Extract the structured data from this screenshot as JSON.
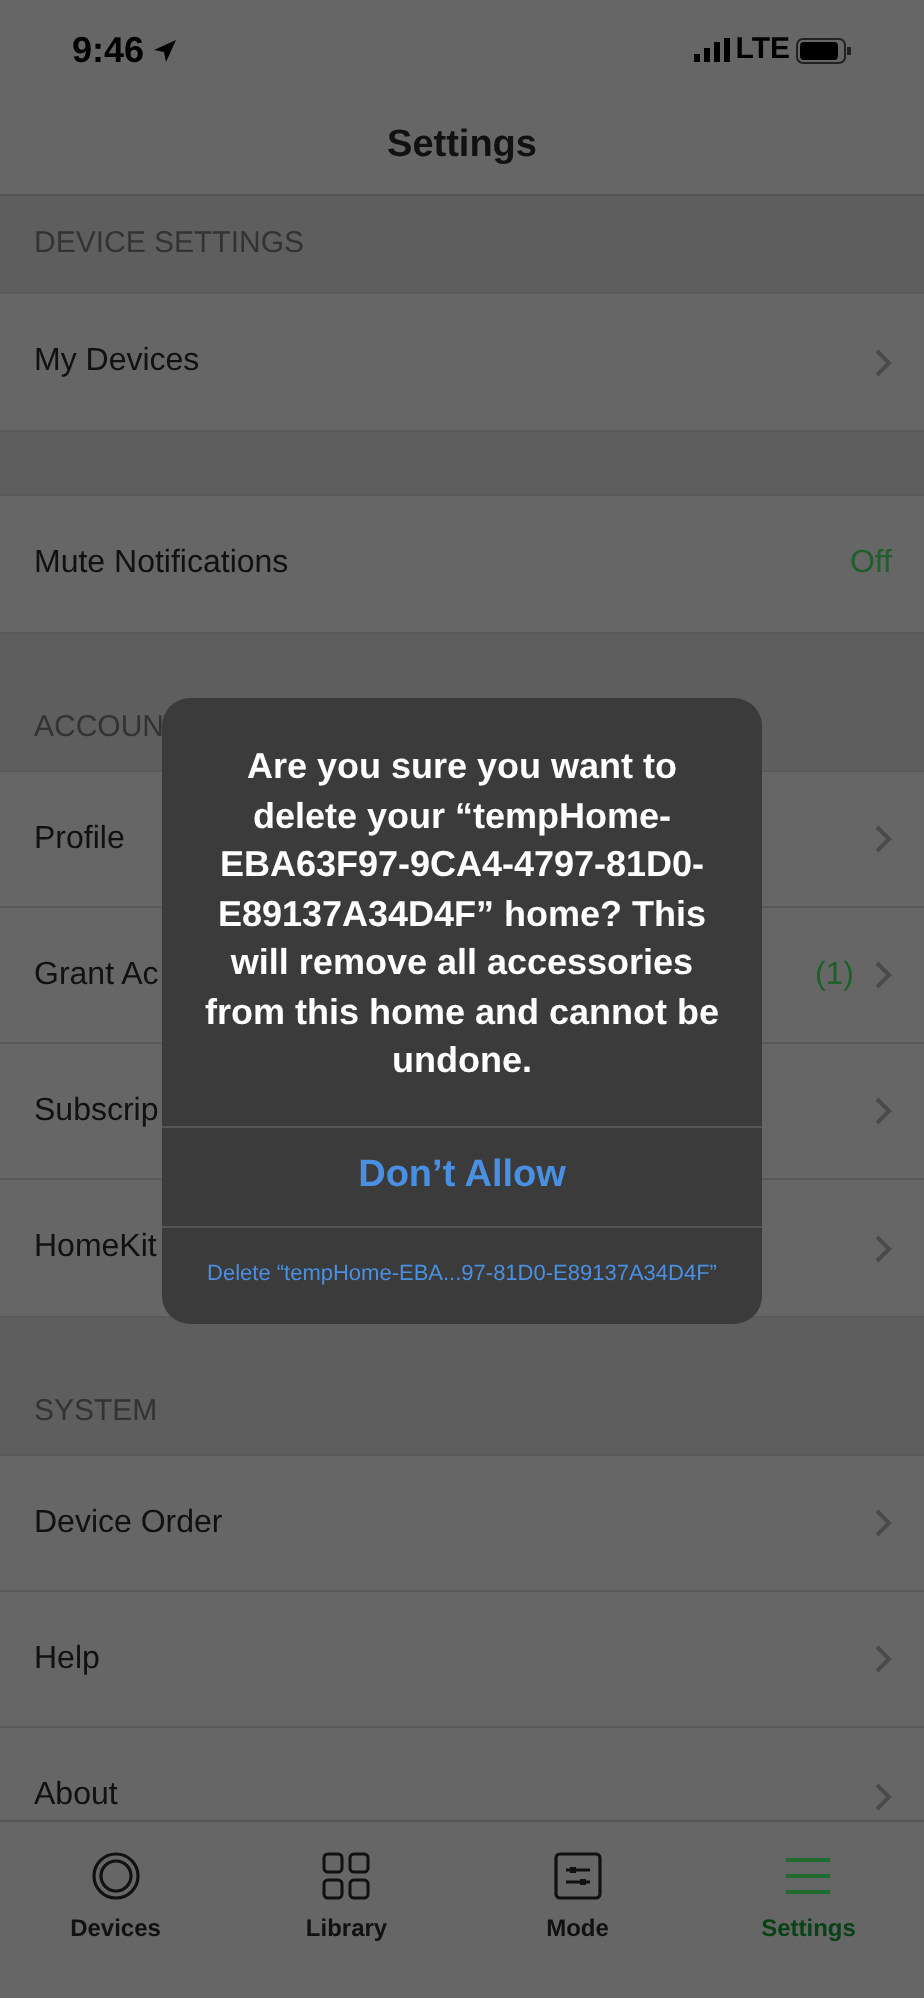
{
  "status_bar": {
    "time": "9:46",
    "network": "LTE"
  },
  "nav": {
    "title": "Settings"
  },
  "sections": [
    {
      "header": "DEVICE SETTINGS",
      "rows": [
        {
          "label": "My Devices",
          "chevron": true
        }
      ]
    },
    {
      "rows": [
        {
          "label": "Mute Notifications",
          "value": "Off",
          "chevron": false
        }
      ]
    },
    {
      "header": "ACCOUN",
      "rows": [
        {
          "label": "Profile",
          "chevron": true
        },
        {
          "label": "Grant Ac",
          "value": "(1)",
          "chevron": true
        },
        {
          "label": "Subscrip",
          "chevron": true
        },
        {
          "label": "HomeKit",
          "chevron": true
        }
      ]
    },
    {
      "header": "SYSTEM",
      "rows": [
        {
          "label": "Device Order",
          "chevron": true
        },
        {
          "label": "Help",
          "chevron": true
        },
        {
          "label": "About",
          "chevron": true
        }
      ]
    }
  ],
  "alert": {
    "message": "Are you sure you want to delete your “tempHome-EBA63F97-9CA4-4797-81D0-E89137A34D4F” home? This will remove all accessories from this home and cannot be undone.",
    "buttons": [
      {
        "label": "Don’t Allow",
        "kind": "primary"
      },
      {
        "label": "Delete “tempHome-EBA...97-81D0-E89137A34D4F”",
        "kind": "small"
      }
    ]
  },
  "tabs": [
    {
      "label": "Devices",
      "selected": false
    },
    {
      "label": "Library",
      "selected": false
    },
    {
      "label": "Mode",
      "selected": false
    },
    {
      "label": "Settings",
      "selected": true
    }
  ]
}
